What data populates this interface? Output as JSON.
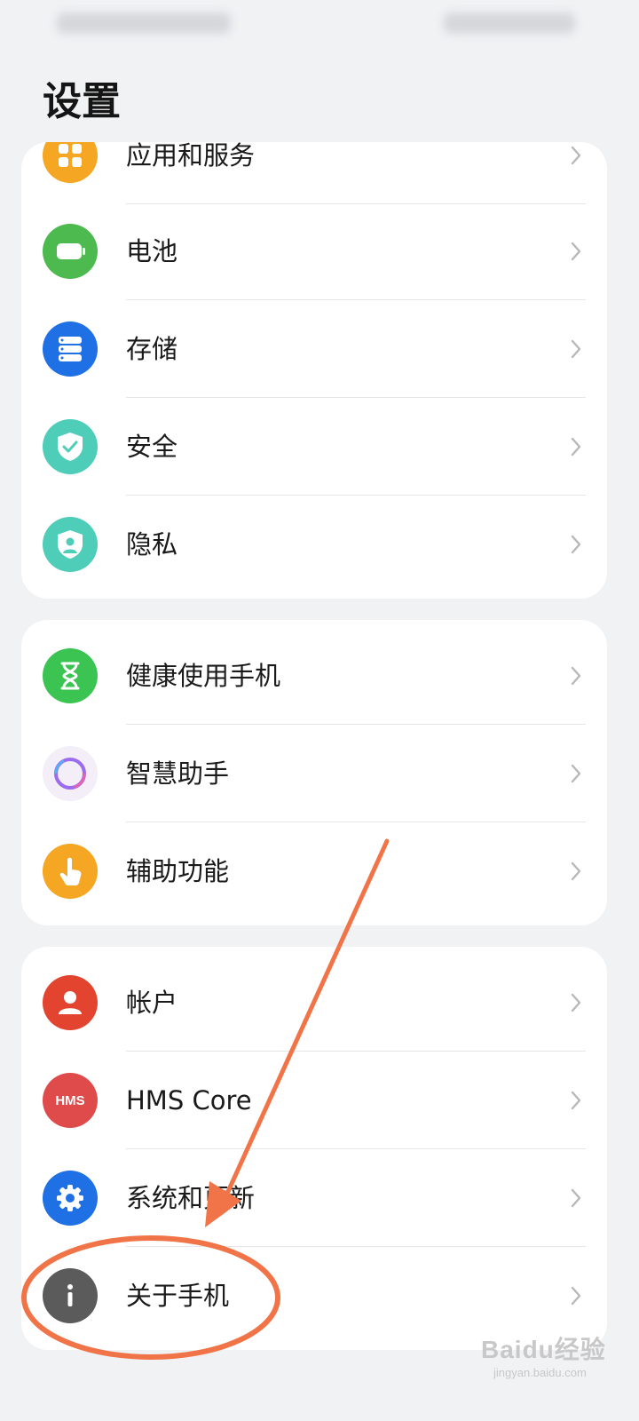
{
  "page": {
    "title": "设置"
  },
  "colors": {
    "background": "#f1f2f4",
    "card": "#ffffff",
    "annotation": "#f07448"
  },
  "groups": [
    {
      "items": [
        {
          "label": "应用和服务",
          "icon": "apps-icon",
          "color": "#f5a623"
        },
        {
          "label": "电池",
          "icon": "battery-icon",
          "color": "#4cba4f"
        },
        {
          "label": "存储",
          "icon": "storage-icon",
          "color": "#1f6fe5"
        },
        {
          "label": "安全",
          "icon": "shield-check-icon",
          "color": "#4ecdb8"
        },
        {
          "label": "隐私",
          "icon": "privacy-shield-icon",
          "color": "#4ecdb8"
        }
      ]
    },
    {
      "items": [
        {
          "label": "健康使用手机",
          "icon": "hourglass-icon",
          "color": "#3cc453"
        },
        {
          "label": "智慧助手",
          "icon": "assistant-ring-icon",
          "color": "#f3eef7"
        },
        {
          "label": "辅助功能",
          "icon": "hand-pointer-icon",
          "color": "#f5a623"
        }
      ]
    },
    {
      "items": [
        {
          "label": "帐户",
          "icon": "account-icon",
          "color": "#e2442f"
        },
        {
          "label": "HMS Core",
          "icon": "hms-icon",
          "icon_text": "HMS",
          "color": "#df4b4b"
        },
        {
          "label": "系统和更新",
          "icon": "gear-icon",
          "color": "#1f6fe5"
        },
        {
          "label": "关于手机",
          "icon": "info-icon",
          "color": "#5b5b5b"
        }
      ]
    }
  ],
  "watermark": {
    "main": "Baidu经验",
    "sub": "jingyan.baidu.com"
  }
}
